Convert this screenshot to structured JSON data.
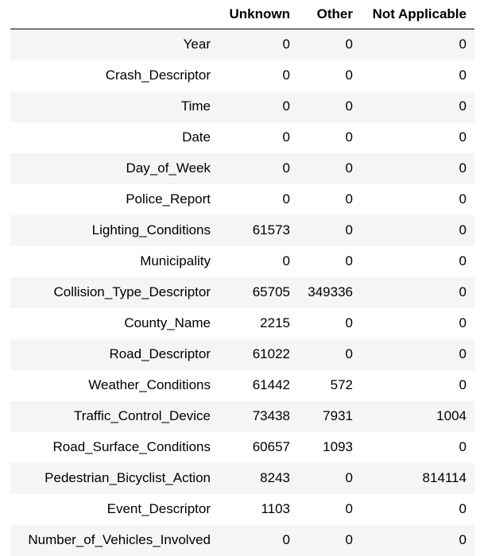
{
  "table": {
    "columns": [
      "",
      "Unknown",
      "Other",
      "Not Applicable"
    ],
    "rows": [
      {
        "label": "Year",
        "unknown": "0",
        "other": "0",
        "not_applicable": "0"
      },
      {
        "label": "Crash_Descriptor",
        "unknown": "0",
        "other": "0",
        "not_applicable": "0"
      },
      {
        "label": "Time",
        "unknown": "0",
        "other": "0",
        "not_applicable": "0"
      },
      {
        "label": "Date",
        "unknown": "0",
        "other": "0",
        "not_applicable": "0"
      },
      {
        "label": "Day_of_Week",
        "unknown": "0",
        "other": "0",
        "not_applicable": "0"
      },
      {
        "label": "Police_Report",
        "unknown": "0",
        "other": "0",
        "not_applicable": "0"
      },
      {
        "label": "Lighting_Conditions",
        "unknown": "61573",
        "other": "0",
        "not_applicable": "0"
      },
      {
        "label": "Municipality",
        "unknown": "0",
        "other": "0",
        "not_applicable": "0"
      },
      {
        "label": "Collision_Type_Descriptor",
        "unknown": "65705",
        "other": "349336",
        "not_applicable": "0"
      },
      {
        "label": "County_Name",
        "unknown": "2215",
        "other": "0",
        "not_applicable": "0"
      },
      {
        "label": "Road_Descriptor",
        "unknown": "61022",
        "other": "0",
        "not_applicable": "0"
      },
      {
        "label": "Weather_Conditions",
        "unknown": "61442",
        "other": "572",
        "not_applicable": "0"
      },
      {
        "label": "Traffic_Control_Device",
        "unknown": "73438",
        "other": "7931",
        "not_applicable": "1004"
      },
      {
        "label": "Road_Surface_Conditions",
        "unknown": "60657",
        "other": "1093",
        "not_applicable": "0"
      },
      {
        "label": "Pedestrian_Bicyclist_Action",
        "unknown": "8243",
        "other": "0",
        "not_applicable": "814114"
      },
      {
        "label": "Event_Descriptor",
        "unknown": "1103",
        "other": "0",
        "not_applicable": "0"
      },
      {
        "label": "Number_of_Vehicles_Involved",
        "unknown": "0",
        "other": "0",
        "not_applicable": "0"
      }
    ]
  }
}
